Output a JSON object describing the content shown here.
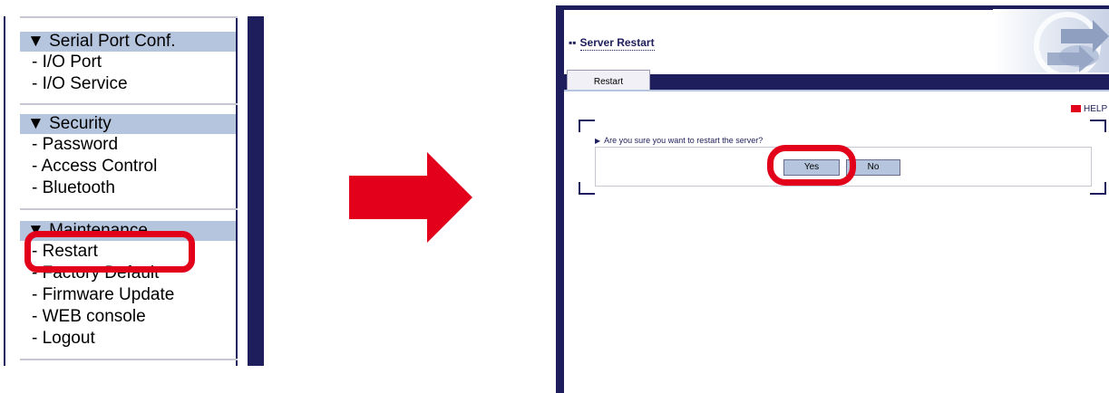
{
  "menu": {
    "sections": [
      {
        "header": "▼ Serial Port Conf.",
        "items": [
          "- I/O Port",
          "- I/O Service"
        ]
      },
      {
        "header": "▼ Security",
        "items": [
          "- Password",
          "- Access Control",
          "- Bluetooth"
        ]
      },
      {
        "header": "▼ Maintenance",
        "items": [
          "- Restart",
          "- Factory Default",
          "- Firmware Update",
          "- WEB console",
          "- Logout"
        ]
      }
    ]
  },
  "server": {
    "title": "Server Restart",
    "title_icon": "grid-icon",
    "tab": "Restart",
    "help": "HELP",
    "question": "Are you sure you want to restart the server?",
    "yes": "Yes",
    "no": "No"
  },
  "colors": {
    "navy": "#1e1e5c",
    "header_blue": "#b6c5de",
    "highlight_red": "#e2001a"
  }
}
